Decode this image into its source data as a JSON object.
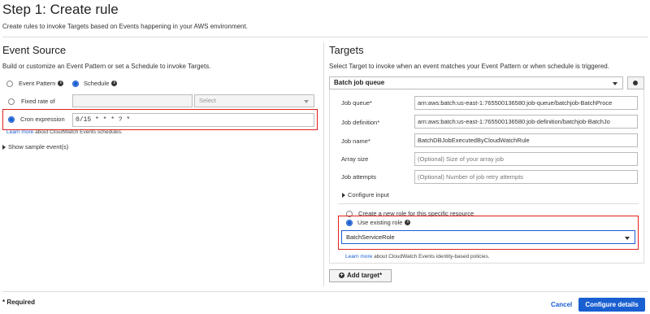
{
  "header": {
    "title": "Step 1: Create rule",
    "subtitle": "Create rules to invoke Targets based on Events happening in your AWS environment."
  },
  "event_source": {
    "title": "Event Source",
    "description": "Build or customize an Event Pattern or set a Schedule to invoke Targets.",
    "event_pattern_label": "Event Pattern",
    "schedule_label": "Schedule",
    "fixed_rate_label": "Fixed rate of",
    "fixed_rate_value": "",
    "unit_placeholder": "Select",
    "cron_label": "Cron expression",
    "cron_value": "0/15 * * * ? *",
    "learn_more_link": "Learn more",
    "learn_more_text": "about CloudWatch Events schedules.",
    "show_sample_label": "Show sample event(s)"
  },
  "targets": {
    "title": "Targets",
    "description": "Select Target to invoke when an event matches your Event Pattern or when schedule is triggered.",
    "target_type": "Batch job queue",
    "fields": [
      {
        "label": "Job queue*",
        "value": "arn:aws:batch:us-east-1:765500136580:job-queue/batchjob-BatchProce",
        "placeholder": ""
      },
      {
        "label": "Job definition*",
        "value": "arn:aws:batch:us-east-1:765500136580:job-definition/batchjob-BatchJo",
        "placeholder": ""
      },
      {
        "label": "Job name*",
        "value": "BatchDBJobExecutedByCloudWatchRule",
        "placeholder": ""
      },
      {
        "label": "Array size",
        "value": "",
        "placeholder": "(Optional) Size of your array job"
      },
      {
        "label": "Job attempts",
        "value": "",
        "placeholder": "(Optional) Number of job retry attempts"
      }
    ],
    "configure_input_label": "Configure input",
    "create_role_label": "Create a new role for this specific resource",
    "use_existing_role_label": "Use existing role",
    "role_value": "BatchServiceRole",
    "learn_more_link": "Learn more",
    "learn_more_text": "about CloudWatch Events identity-based policies.",
    "add_target_label": "Add target*"
  },
  "footer": {
    "required_note": "* Required",
    "cancel_label": "Cancel",
    "configure_details_label": "Configure details"
  },
  "colors": {
    "accent": "#1a5fd1",
    "highlight": "#e0201c"
  }
}
